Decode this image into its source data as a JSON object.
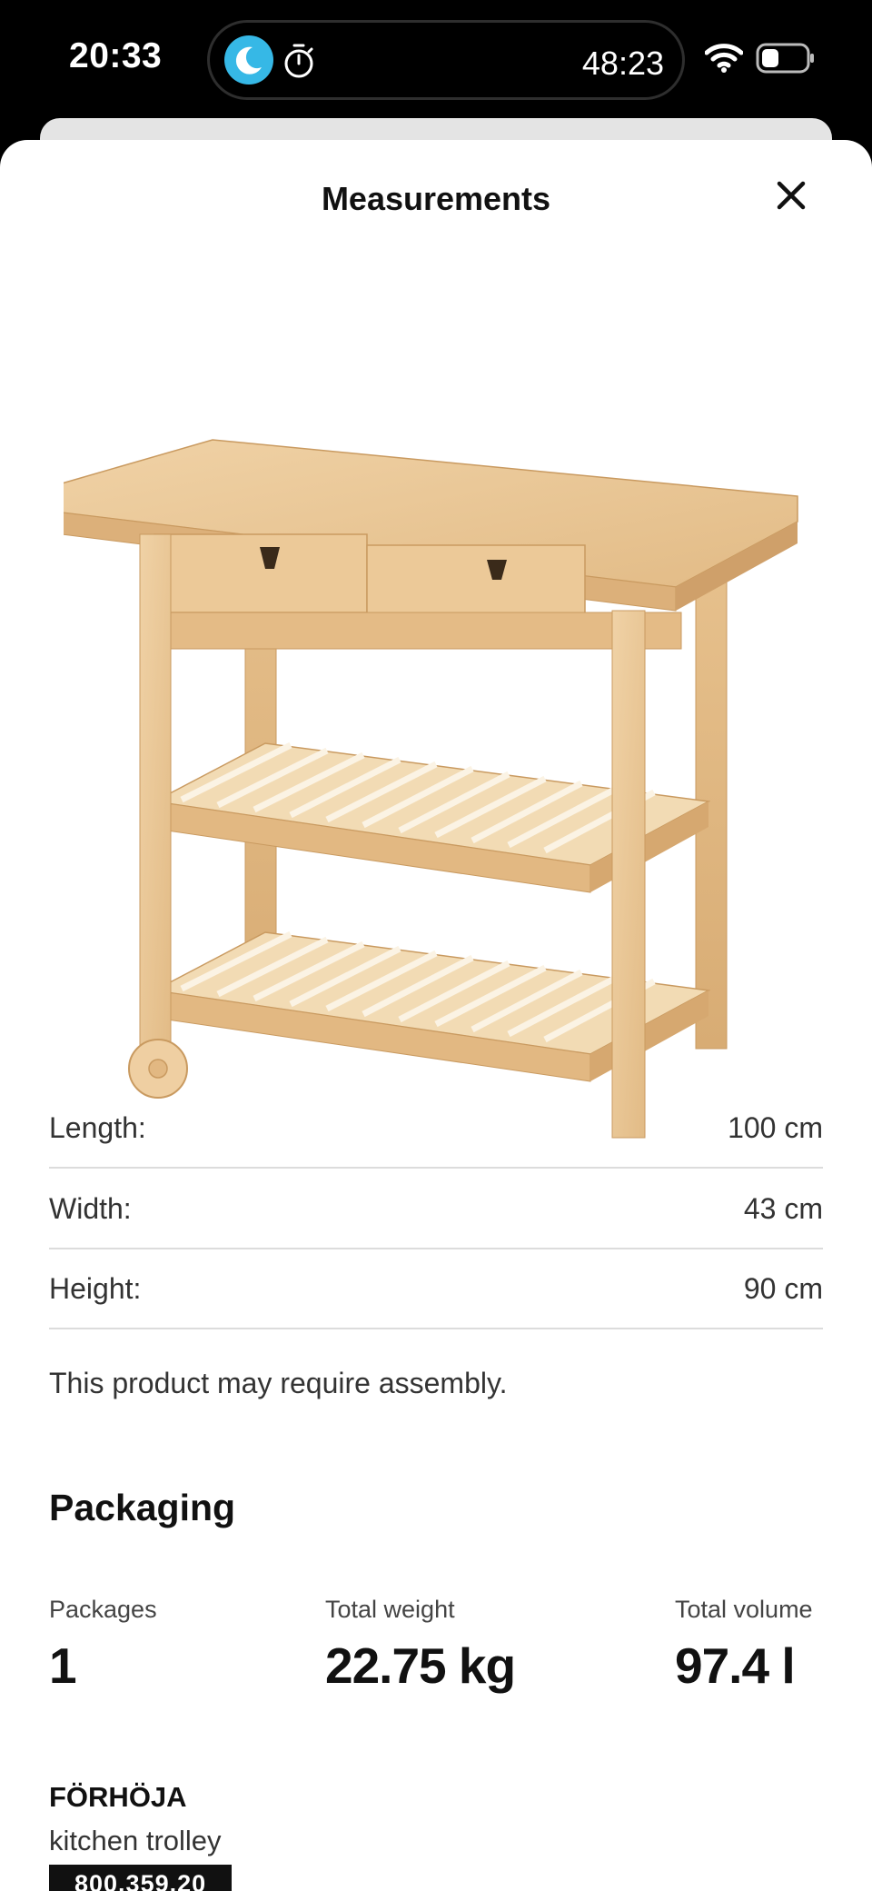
{
  "status_bar": {
    "time": "20:33",
    "island_timer": "48:23",
    "icons": [
      "moon-icon",
      "timer-icon",
      "wifi-icon",
      "battery-icon"
    ],
    "moon_color": "#36b8e6"
  },
  "sheet": {
    "title": "Measurements",
    "close_icon": "close-icon"
  },
  "measurements": [
    {
      "label": "Length:",
      "value": "100 cm"
    },
    {
      "label": "Width:",
      "value": "43 cm"
    },
    {
      "label": "Height:",
      "value": "90 cm"
    }
  ],
  "assembly_note": "This product may require assembly.",
  "packaging": {
    "title": "Packaging",
    "packages_label": "Packages",
    "packages_value": "1",
    "weight_label": "Total weight",
    "weight_value": "22.75 kg",
    "volume_label": "Total volume",
    "volume_value": "97.4 l"
  },
  "product": {
    "name": "FÖRHÖJA",
    "description": "kitchen trolley",
    "article_number": "800.359.20"
  }
}
